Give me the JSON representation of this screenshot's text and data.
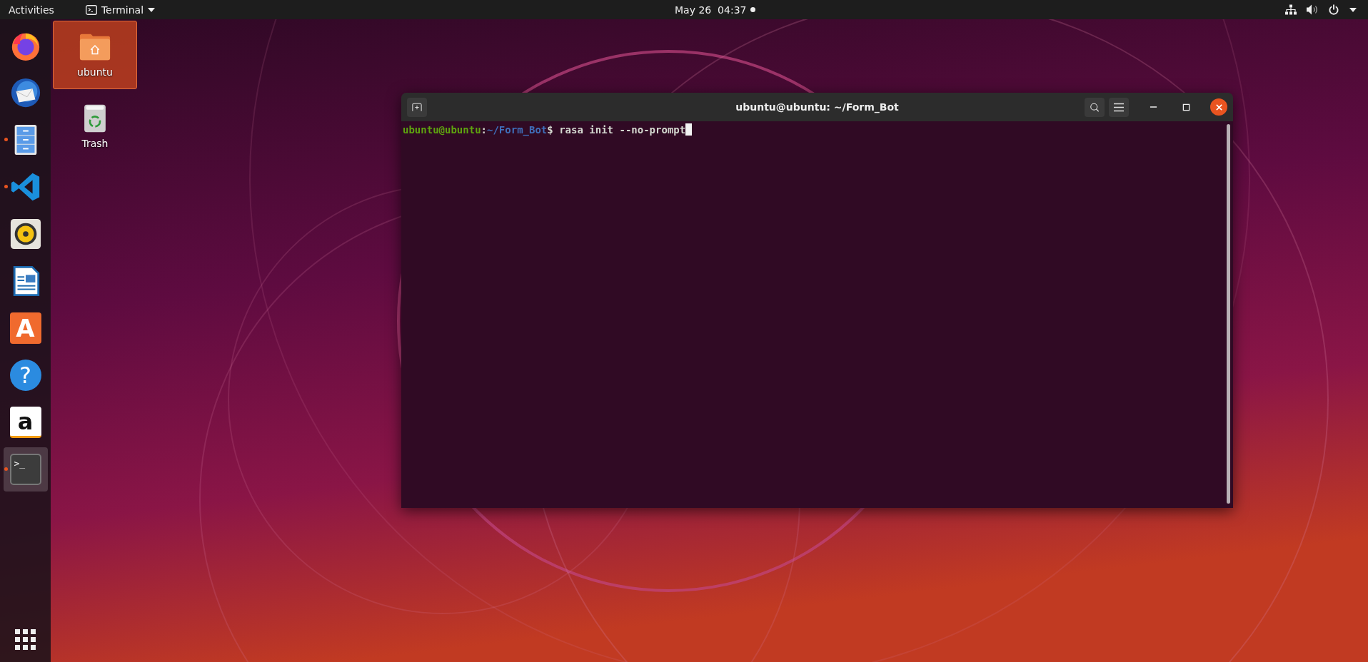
{
  "top_bar": {
    "activities": "Activities",
    "app_menu": "Terminal",
    "clock": "May 26  04:37",
    "notification": true
  },
  "dock": {
    "items": [
      {
        "kind": "browser",
        "running": false,
        "selected": false
      },
      {
        "kind": "mail",
        "running": false,
        "selected": false
      },
      {
        "kind": "files",
        "running": true,
        "selected": false
      },
      {
        "kind": "code",
        "running": true,
        "selected": false
      },
      {
        "kind": "music",
        "running": false,
        "selected": false
      },
      {
        "kind": "writer",
        "running": false,
        "selected": false
      },
      {
        "kind": "store",
        "running": false,
        "selected": false,
        "glyph": "A"
      },
      {
        "kind": "help",
        "running": false,
        "selected": false,
        "glyph": "?"
      },
      {
        "kind": "shop",
        "running": false,
        "selected": false,
        "glyph": "a"
      },
      {
        "kind": "terminal",
        "running": true,
        "selected": true,
        "glyph": ">_"
      }
    ]
  },
  "desktop_icons": [
    {
      "kind": "home",
      "label": "ubuntu",
      "selected": true
    },
    {
      "kind": "trash",
      "label": "Trash",
      "selected": false
    }
  ],
  "terminal": {
    "title": "ubuntu@ubuntu: ~/Form_Bot",
    "lines": [
      {
        "user": "ubuntu@ubuntu",
        "separator": ":",
        "path": "~/Form_Bot",
        "symbol": "$",
        "command": " rasa init --no-prompt",
        "cursor": true
      }
    ]
  }
}
